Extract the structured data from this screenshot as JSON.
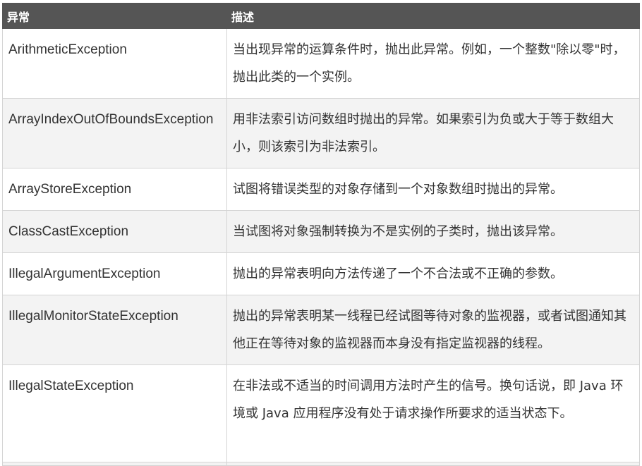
{
  "headers": {
    "col1": "异常",
    "col2": "描述"
  },
  "rows": [
    {
      "name": "ArithmeticException",
      "desc": "当出现异常的运算条件时，抛出此异常。例如，一个整数\"除以零\"时，抛出此类的一个实例。"
    },
    {
      "name": "ArrayIndexOutOfBoundsException",
      "desc": "用非法索引访问数组时抛出的异常。如果索引为负或大于等于数组大小，则该索引为非法索引。"
    },
    {
      "name": "ArrayStoreException",
      "desc": "试图将错误类型的对象存储到一个对象数组时抛出的异常。"
    },
    {
      "name": "ClassCastException",
      "desc": "当试图将对象强制转换为不是实例的子类时，抛出该异常。"
    },
    {
      "name": "IllegalArgumentException",
      "desc": "抛出的异常表明向方法传递了一个不合法或不正确的参数。"
    },
    {
      "name": "IllegalMonitorStateException",
      "desc": "抛出的异常表明某一线程已经试图等待对象的监视器，或者试图通知其他正在等待对象的监视器而本身没有指定监视器的线程。"
    },
    {
      "name": "IllegalStateException",
      "desc": "在非法或不适当的时间调用方法时产生的信号。换句话说，即 Java 环境或 Java 应用程序没有处于请求操作所要求的适当状态下。"
    }
  ]
}
